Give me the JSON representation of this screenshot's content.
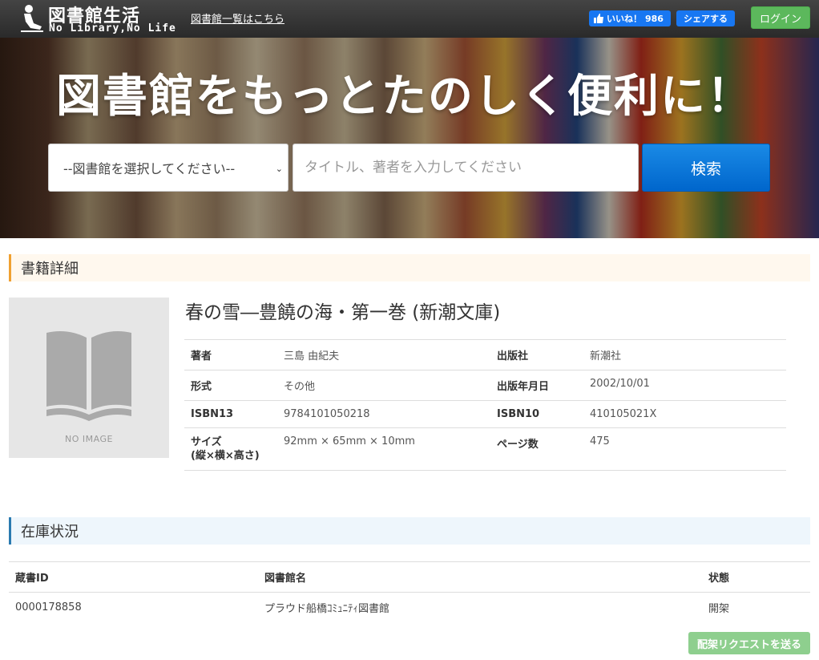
{
  "header": {
    "title": "図書館生活",
    "subtitle": "No Library,No Life",
    "nav_link": "図書館一覧はこちら",
    "fb_like_label": "いいね！",
    "fb_like_count": "986",
    "fb_share_label": "シェアする",
    "login_label": "ログイン"
  },
  "hero": {
    "headline": "図書館をもっとたのしく便利に！",
    "library_select_value": "--図書館を選択してください--",
    "search_placeholder": "タイトル、著者を入力してください",
    "search_button": "検索"
  },
  "detail": {
    "section_title": "書籍詳細",
    "no_image_text": "NO IMAGE",
    "book_title": "春の雪―豊饒の海・第一巻 (新潮文庫)",
    "rows": [
      {
        "k1": "著者",
        "v1": "三島 由紀夫",
        "k2": "出版社",
        "v2": "新潮社"
      },
      {
        "k1": "形式",
        "v1": "その他",
        "k2": "出版年月日",
        "v2": "2002/10/01"
      },
      {
        "k1": "ISBN13",
        "v1": "9784101050218",
        "k2": "ISBN10",
        "v2": "410105021X"
      },
      {
        "k1": "サイズ\n(縦×横×高さ)",
        "v1": "92mm × 65mm × 10mm",
        "k2": "ページ数",
        "v2": "475"
      }
    ]
  },
  "stock": {
    "section_title": "在庫状況",
    "headers": [
      "蔵書ID",
      "図書館名",
      "状態"
    ],
    "rows": [
      {
        "id": "0000178858",
        "library": "プラウド船橋ｺﾐｭﾆﾃｨ図書館",
        "status": "開架"
      }
    ],
    "request_button": "配架リクエストを送る"
  },
  "colors": {
    "header_bg": "#333333",
    "fb_blue": "#1877f2",
    "login_green": "#5cb85c",
    "search_blue": "#0a78d8",
    "detail_accent": "#f0a030",
    "stock_accent": "#2a7ab0"
  }
}
